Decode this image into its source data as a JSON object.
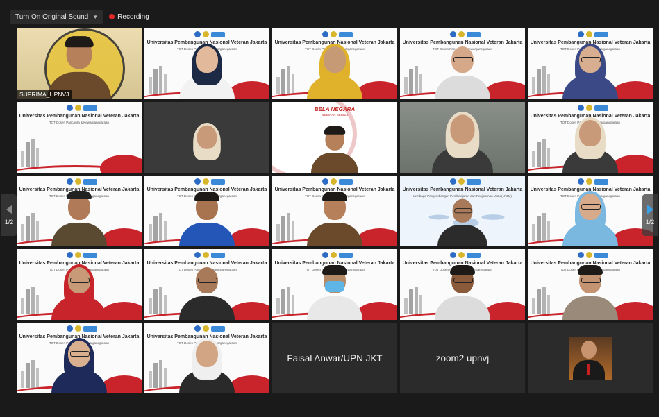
{
  "toolbar": {
    "original_sound_label": "Turn On Original Sound",
    "recording_label": "Recording"
  },
  "slide": {
    "university": "Universitas Pembangunan Nasional Veteran Jakarta",
    "subtitle": "TOT Dosen Pancasila & Kewarganegaraan",
    "map_subtitle": "Lembaga Pengembangan Pembelajaran dan Penjaminan Mutu (LP3M)",
    "bela_title": "BELA NEGARA",
    "bela_subtitle": "WEBINAR SERIES"
  },
  "tiles": [
    {
      "type": "active",
      "name": "SUPRIMA_UPNVJ"
    },
    {
      "type": "slide-person",
      "variant": "hijab-white"
    },
    {
      "type": "slide-person",
      "variant": "hijab-yellow"
    },
    {
      "type": "slide-person",
      "variant": "man-glasses"
    },
    {
      "type": "slide-person",
      "variant": "hijab-glasses"
    },
    {
      "type": "slide"
    },
    {
      "type": "dark-person"
    },
    {
      "type": "bela"
    },
    {
      "type": "room-person"
    },
    {
      "type": "slide-person",
      "variant": "hijab-cream"
    },
    {
      "type": "slide-person",
      "variant": "man-hat"
    },
    {
      "type": "slide-person",
      "variant": "man-blue"
    },
    {
      "type": "slide-person",
      "variant": "man-batik"
    },
    {
      "type": "map-person"
    },
    {
      "type": "slide-person",
      "variant": "hijab-blue"
    },
    {
      "type": "slide-person",
      "variant": "hijab-red"
    },
    {
      "type": "slide-person",
      "variant": "man-small"
    },
    {
      "type": "slide-person",
      "variant": "man-mask"
    },
    {
      "type": "slide-person",
      "variant": "man-dark"
    },
    {
      "type": "slide-person",
      "variant": "man-young"
    },
    {
      "type": "slide-person",
      "variant": "hijab-navy"
    },
    {
      "type": "slide-person",
      "variant": "hijab-white-small"
    },
    {
      "type": "name-only",
      "name": "Faisal Anwar/UPN JKT"
    },
    {
      "type": "name-only",
      "name": "zoom2 upnvj"
    },
    {
      "type": "avatar"
    }
  ],
  "pagination": {
    "left_label": "1/2",
    "right_label": "1/2"
  },
  "colors": {
    "accent_active": "#d6e34a",
    "record_red": "#e02828",
    "slide_red": "#c9232b",
    "nav_blue": "#3aa0e8"
  }
}
